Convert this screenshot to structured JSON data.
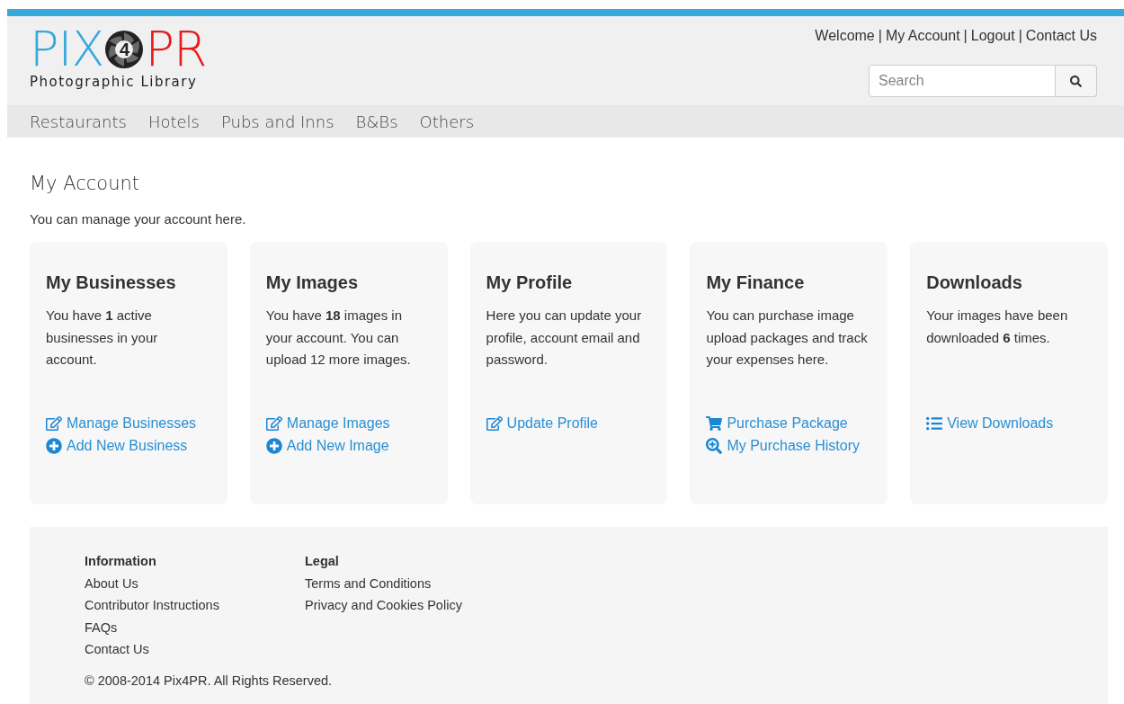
{
  "logo": {
    "left": "PIX",
    "mark": "4",
    "right": "PR",
    "tagline": "Photographic Library"
  },
  "top_links": [
    "Welcome",
    "My Account",
    "Logout",
    "Contact Us"
  ],
  "top_separator": "|",
  "search": {
    "placeholder": "Search"
  },
  "nav": [
    "Restaurants",
    "Hotels",
    "Pubs and Inns",
    "B&Bs",
    "Others"
  ],
  "page": {
    "title": "My Account",
    "intro": "You can manage your account here."
  },
  "cards": [
    {
      "title": "My Businesses",
      "body": "You have **1** active businesses in your account.",
      "links": [
        {
          "kind": "edit",
          "label": "Manage Businesses"
        },
        {
          "kind": "add",
          "label": "Add New Business"
        }
      ]
    },
    {
      "title": "My Images",
      "body": "You have **18** images in your account. You can upload 12 more images.",
      "links": [
        {
          "kind": "edit",
          "label": "Manage Images"
        },
        {
          "kind": "add",
          "label": "Add New Image"
        }
      ]
    },
    {
      "title": "My Profile",
      "body": "Here you can update your profile, account email and password.",
      "links": [
        {
          "kind": "edit",
          "label": "Update Profile"
        }
      ]
    },
    {
      "title": "My Finance",
      "body": "You can purchase image upload packages and track your expenses here.",
      "links": [
        {
          "kind": "cart",
          "label": "Purchase Package"
        },
        {
          "kind": "zoom",
          "label": "My Purchase History"
        }
      ]
    },
    {
      "title": "Downloads",
      "body": "Your images have been downloaded **6** times.",
      "links": [
        {
          "kind": "list",
          "label": "View Downloads"
        }
      ]
    }
  ],
  "footer": {
    "columns": [
      {
        "heading": "Information",
        "links": [
          "About Us",
          "Contributor Instructions",
          "FAQs",
          "Contact Us"
        ]
      },
      {
        "heading": "Legal",
        "links": [
          "Terms and Conditions",
          "Privacy and Cookies Policy"
        ]
      }
    ],
    "copyright": "© 2008-2014 Pix4PR. All Rights Reserved."
  }
}
